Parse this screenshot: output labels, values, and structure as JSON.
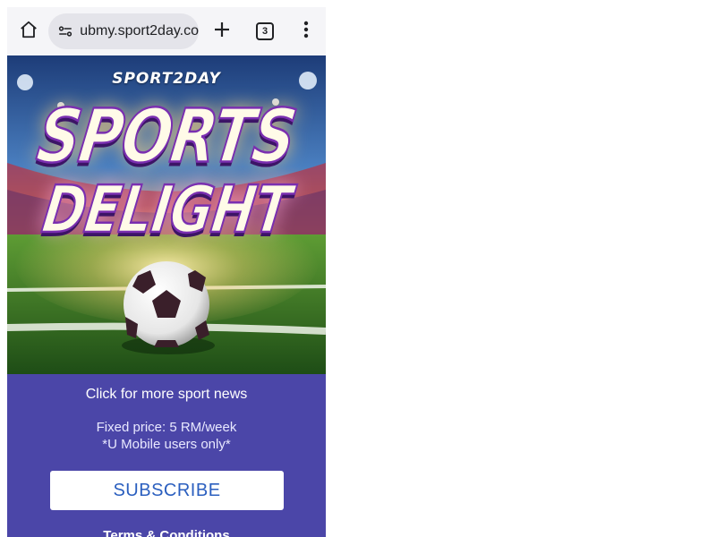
{
  "browser": {
    "url": "ubmy.sport2day.co",
    "tab_count": "3",
    "icons": {
      "home": "home-icon",
      "site_settings": "tune-icon",
      "new_tab": "plus-icon",
      "menu": "more-vert-icon"
    }
  },
  "banner": {
    "brand": "SPORT2DAY",
    "headline_line1": "SPORTS",
    "headline_line2": "DELIGHT"
  },
  "promo": {
    "more_news_link": "Click for more sport news",
    "price_text": "Fixed price: 5 RM/week",
    "eligibility_text": "*U Mobile users only*",
    "subscribe_label": "SUBSCRIBE",
    "terms_link": "Terms & Conditions",
    "background_color": "#4b46a8",
    "button_text_color": "#2b5fbf"
  }
}
